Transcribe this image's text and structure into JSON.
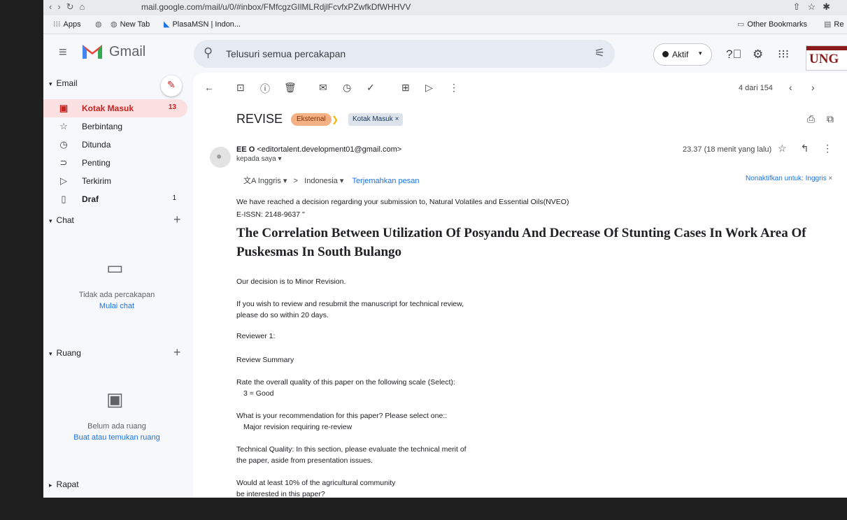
{
  "browser": {
    "url": "mail.google.com/mail/u/0/#inbox/FMfcgzGIlMLRdjlFcvfxPZwfkDfWHHVV",
    "bookmarks": {
      "apps": "Apps",
      "newtab": "New Tab",
      "plasa": "PlasaMSN | Indon...",
      "other": "Other Bookmarks",
      "reading": "Re"
    }
  },
  "gmail": {
    "logo": "Gmail",
    "search_placeholder": "Telusuri semua percakapan",
    "status": "Aktif",
    "account_logo": "UNG"
  },
  "sidebar": {
    "email_section": "Email",
    "items": [
      {
        "label": "Kotak Masuk",
        "count": "13",
        "icon": "inbox-icon"
      },
      {
        "label": "Berbintang",
        "count": "",
        "icon": "star-icon"
      },
      {
        "label": "Ditunda",
        "count": "",
        "icon": "clock-icon"
      },
      {
        "label": "Penting",
        "count": "",
        "icon": "important-icon"
      },
      {
        "label": "Terkirim",
        "count": "",
        "icon": "send-icon"
      },
      {
        "label": "Draf",
        "count": "1",
        "icon": "draft-icon"
      }
    ],
    "chat_section": "Chat",
    "chat_empty": "Tidak ada percakapan",
    "chat_link": "Mulai chat",
    "rooms_section": "Ruang",
    "rooms_empty": "Belum ada ruang",
    "rooms_link": "Buat atau temukan ruang",
    "meet_section": "Rapat"
  },
  "toolbar": {
    "page_count": "4 dari 154"
  },
  "message": {
    "subject": "REVISE",
    "badge_external": "Eksternal",
    "label_inbox": "Kotak Masuk ×",
    "sender_name": "EE O",
    "sender_email": "<editortalent.development01@gmail.com>",
    "to": "kepada saya ▾",
    "time": "23.37 (18 menit yang lalu)",
    "translate_from": "Inggris ▾",
    "translate_to": "Indonesia ▾",
    "translate_link": "Terjemahkan pesan",
    "translate_off": "Nonaktifkan untuk: Inggris",
    "body": {
      "l1": "We have reached a decision regarding your submission to, Natural Volatiles and Essential Oils(NVEO)",
      "l2": "E-ISSN: 2148-9637 \"",
      "title": "The Correlation Between Utilization Of Posyandu And Decrease Of Stunting Cases In Work Area Of Puskesmas In South Bulango",
      "l3": "Our decision is to Minor Revision.",
      "l4": "If you wish to review and resubmit the manuscript for technical review,",
      "l5": "please do so within 20 days.",
      "l6": "Reviewer 1:",
      "l7": "Review Summary",
      "l8": "Rate the overall quality of this paper on the following scale (Select):",
      "l9": "3 = Good",
      "l10": "What is your recommendation for this paper? Please select one::",
      "l11": "Major revision requiring re-review",
      "l12": "Technical Quality: In this section, please evaluate the technical merit of",
      "l13": "the paper, aside from presentation issues.",
      "l14": "Would at least 10% of the agricultural community",
      "l15": "be interested in this paper?"
    }
  }
}
